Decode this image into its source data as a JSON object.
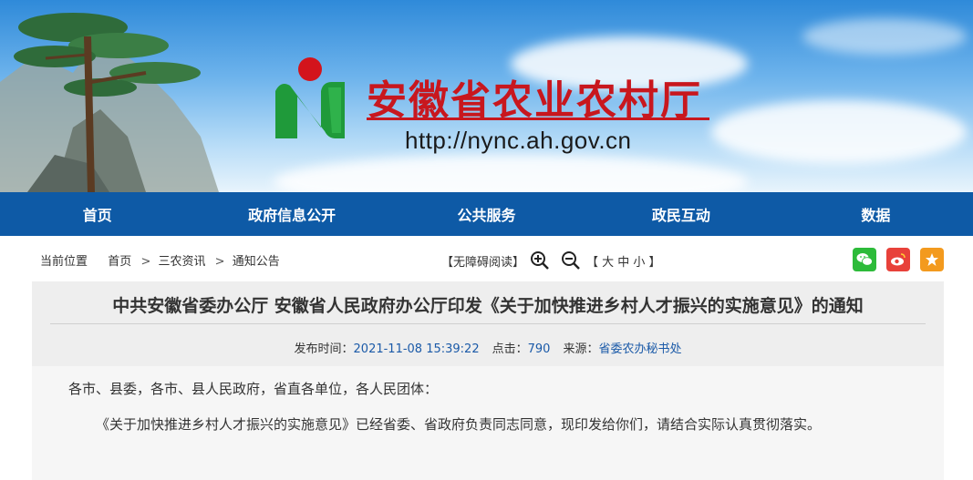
{
  "site": {
    "title": "安徽省农业农村厅",
    "url": "http://nync.ah.gov.cn"
  },
  "nav": {
    "items": [
      "首页",
      "政府信息公开",
      "公共服务",
      "政民互动",
      "数据"
    ]
  },
  "breadcrumb": {
    "label": "当前位置",
    "items": [
      "首页",
      "三农资讯",
      "通知公告"
    ],
    "separator": ">"
  },
  "accessibility": {
    "barrier_free": "【无障碍阅读】",
    "font_size": "【 大 中 小 】"
  },
  "share_icons": [
    "wechat-icon",
    "weibo-icon",
    "favorite-icon"
  ],
  "article": {
    "title": "中共安徽省委办公厅 安徽省人民政府办公厅印发《关于加快推进乡村人才振兴的实施意见》的通知",
    "publish_label": "发布时间：",
    "publish_time": "2021-11-08 15:39:22",
    "clicks_label": "点击：",
    "clicks": "790",
    "source_label": "来源：",
    "source": "省委农办秘书处",
    "paragraphs": [
      "各市、县委，各市、县人民政府，省直各单位，各人民团体：",
      "《关于加快推进乡村人才振兴的实施意见》已经省委、省政府负责同志同意，现印发给你们，请结合实际认真贯彻落实。"
    ]
  },
  "colors": {
    "brand_red": "#c8171e",
    "nav_blue": "#0e5aa6",
    "link_blue": "#1b5aa8"
  }
}
